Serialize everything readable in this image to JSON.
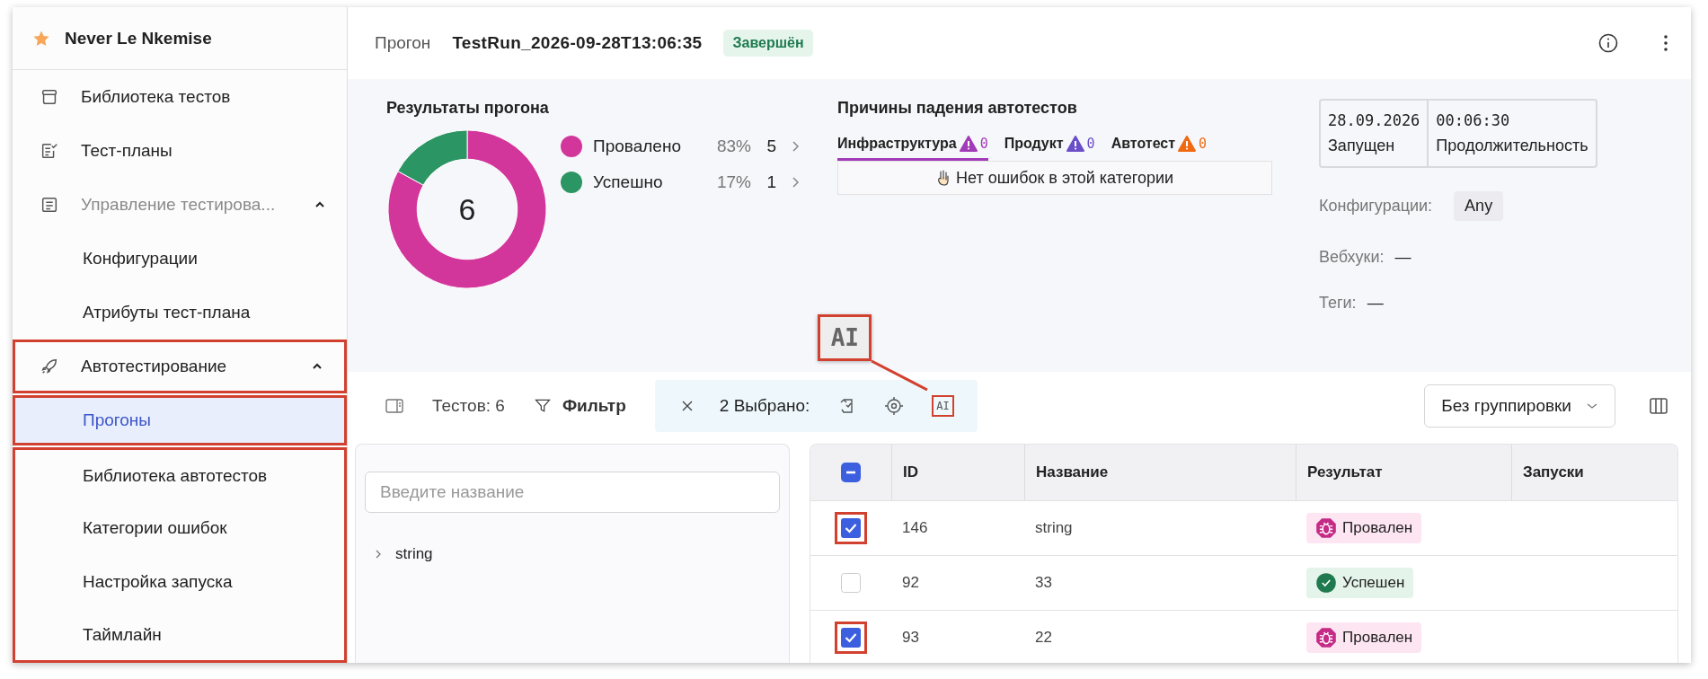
{
  "sidebar": {
    "project": "Never Le Nkemise",
    "items": [
      {
        "kind": "link",
        "label": "Библиотека тестов",
        "dimmed": false,
        "marked": false
      },
      {
        "kind": "link",
        "label": "Тест-планы",
        "dimmed": false,
        "marked": false
      },
      {
        "kind": "group",
        "label": "Управление тестирова...",
        "dimmed": true,
        "expanded": true,
        "marked": false,
        "children": [
          {
            "label": "Конфигурации",
            "selected": false,
            "marked": false
          },
          {
            "label": "Атрибуты тест-плана",
            "selected": false,
            "marked": false
          }
        ]
      },
      {
        "kind": "group",
        "label": "Автотестирование",
        "dimmed": false,
        "expanded": true,
        "marked": true,
        "children": [
          {
            "label": "Прогоны",
            "selected": true,
            "marked": true
          },
          {
            "label": "Библиотека автотестов",
            "selected": false,
            "marked": true
          },
          {
            "label": "Категории ошибок",
            "selected": false,
            "marked": true
          },
          {
            "label": "Настройка запуска",
            "selected": false,
            "marked": true
          },
          {
            "label": "Таймлайн",
            "selected": false,
            "marked": true
          }
        ]
      }
    ]
  },
  "header": {
    "label": "Прогон",
    "title": "TestRun_2026-09-28T13:06:35",
    "status": "Завершён"
  },
  "results": {
    "title": "Результаты прогона",
    "total": "6",
    "chart_data": {
      "type": "donut",
      "categories": [
        "Провалено",
        "Успешно"
      ],
      "series": [
        {
          "values": [
            83,
            17
          ]
        }
      ]
    },
    "legend": [
      {
        "percent": "83%",
        "count": "5",
        "color": "#d3369b"
      },
      {
        "percent": "17%",
        "count": "1",
        "color": "#2b9563"
      }
    ]
  },
  "causes": {
    "title": "Причины падения автотестов",
    "tabs": [
      {
        "label": "Инфраструктура",
        "count": "0",
        "color": "#a23bb8",
        "selected": true
      },
      {
        "label": "Продукт",
        "count": "0",
        "color": "#6a4fc9",
        "selected": false
      },
      {
        "label": "Автотест",
        "count": "0",
        "color": "#f06a12",
        "selected": false
      }
    ],
    "empty": "Нет ошибок в этой категории"
  },
  "info": {
    "cells": [
      {
        "value": "28.09.2026",
        "label": "Запущен"
      },
      {
        "value": "00:06:30",
        "label": "Продолжительность"
      }
    ],
    "configurations": {
      "label": "Конфигурации:",
      "tag": "Any"
    },
    "webhooks": {
      "label": "Вебхуки:",
      "value": "—"
    },
    "tags": {
      "label": "Теги:",
      "value": "—"
    }
  },
  "toolbar": {
    "count": "Тестов: 6",
    "filter": "Фильтр",
    "selection": {
      "text": "2 Выбрано:",
      "actions": [
        {
          "kind": "rerun",
          "marked": false
        },
        {
          "kind": "target",
          "marked": false
        },
        {
          "kind": "ai",
          "label": "AI",
          "marked": true,
          "callout": "AI"
        }
      ]
    },
    "grouping": "Без группировки"
  },
  "tree": {
    "placeholder": "Введите название",
    "nodes": [
      {
        "label": "string",
        "expanded": false
      }
    ]
  },
  "table": {
    "header_indeterminate": true,
    "columns": [
      "ID",
      "Название",
      "Результат",
      "Запуски"
    ],
    "rows": [
      {
        "checked": true,
        "marked": true,
        "id": "146",
        "name": "string",
        "result": {
          "kind": "failed",
          "label": "Провален"
        }
      },
      {
        "checked": false,
        "marked": false,
        "id": "92",
        "name": "33",
        "result": {
          "kind": "passed",
          "label": "Успешен"
        }
      },
      {
        "checked": true,
        "marked": true,
        "id": "93",
        "name": "22",
        "result": {
          "kind": "failed",
          "label": "Провален"
        }
      }
    ]
  }
}
